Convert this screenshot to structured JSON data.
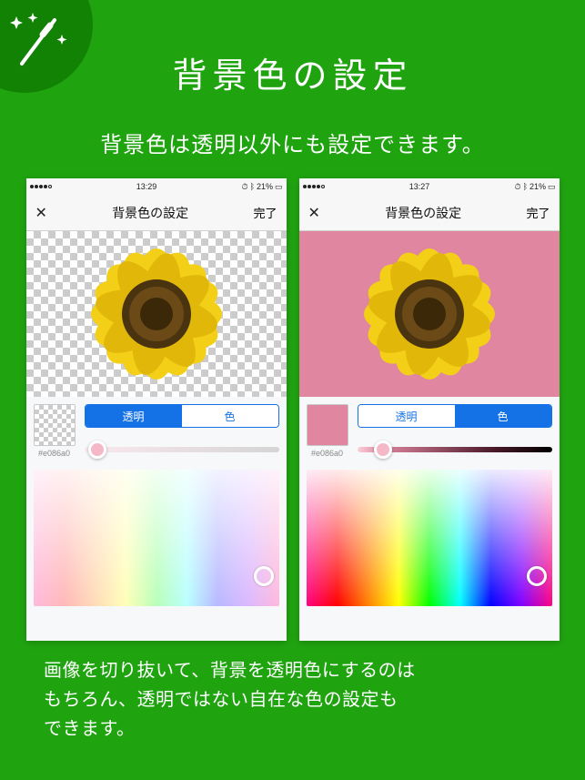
{
  "hero": {
    "title": "背景色の設定",
    "subtitle": "背景色は透明以外にも設定できます。"
  },
  "icon": {
    "name": "magic-wand-icon"
  },
  "phones": [
    {
      "status": {
        "time": "13:29",
        "battery": "21%"
      },
      "nav": {
        "title": "背景色の設定",
        "done": "完了"
      },
      "hex": "#e086a0",
      "seg": {
        "transparent": "透明",
        "color": "色",
        "active": "transparent"
      },
      "preview_mode": "transparent"
    },
    {
      "status": {
        "time": "13:27",
        "battery": "21%"
      },
      "nav": {
        "title": "背景色の設定",
        "done": "完了"
      },
      "hex": "#e086a0",
      "seg": {
        "transparent": "透明",
        "color": "色",
        "active": "color"
      },
      "preview_mode": "solid",
      "bg_color": "#e086a0"
    }
  ],
  "footer": {
    "line1": "画像を切り抜いて、背景を透明色にするのは",
    "line2": "もちろん、透明ではない自在な色の設定も",
    "line3": "できます。"
  }
}
